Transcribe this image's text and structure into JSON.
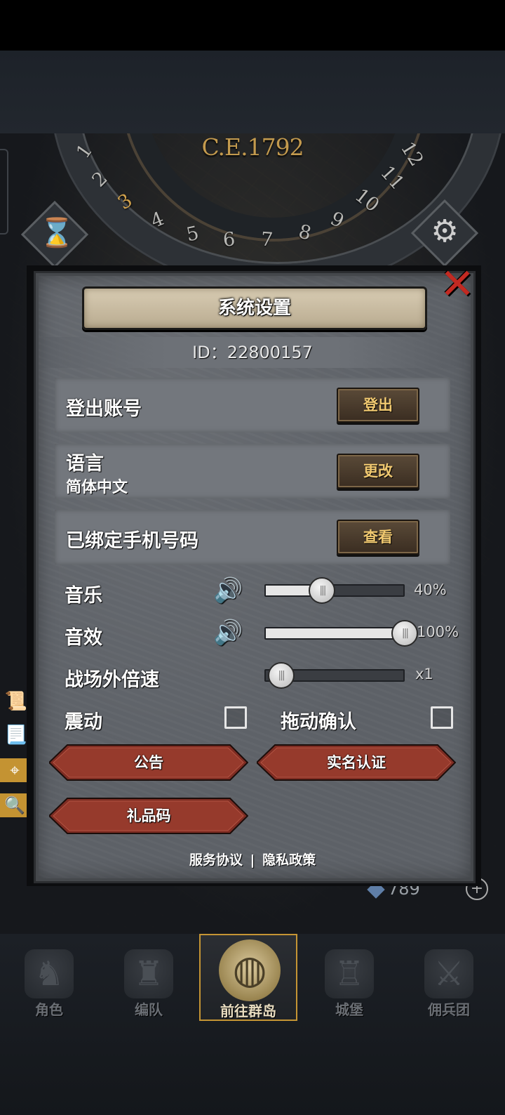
{
  "calendar": {
    "year": "C.E.1792",
    "months": [
      "1",
      "2",
      "3",
      "4",
      "5",
      "6",
      "7",
      "8",
      "9",
      "10",
      "11",
      "12"
    ],
    "active_month": "3"
  },
  "dialog": {
    "title": "系统设置",
    "id_line": "ID：22800157",
    "rows": [
      {
        "label": "登出账号",
        "button": "登出"
      },
      {
        "label": "语言",
        "sub": "简体中文",
        "button": "更改"
      },
      {
        "label": "已绑定手机号码",
        "button": "查看"
      }
    ],
    "music": {
      "label": "音乐",
      "percent_text": "40%",
      "level": 0.4
    },
    "sfx": {
      "label": "音效",
      "percent_text": "100%",
      "level": 1.0
    },
    "speed": {
      "label": "战场外倍速",
      "value_text": "x1",
      "level": 0.0
    },
    "vibration": {
      "label": "震动",
      "checked": false
    },
    "drag_confirm": {
      "label": "拖动确认",
      "checked": false
    },
    "buttons": {
      "announcement": "公告",
      "realname": "实名认证",
      "giftcode": "礼品码"
    },
    "footer": {
      "service": "服务协议",
      "separator": "|",
      "privacy": "隐私政策"
    }
  },
  "resource": {
    "value": "789"
  },
  "nav": [
    {
      "label": "角色",
      "icon": "knight-helmet-icon"
    },
    {
      "label": "编队",
      "icon": "helmet-icon"
    },
    {
      "label": "前往群岛",
      "icon": "globe-icon",
      "active": true
    },
    {
      "label": "城堡",
      "icon": "castle-icon"
    },
    {
      "label": "佣兵团",
      "icon": "mercenary-icon"
    }
  ],
  "colors": {
    "accent_gold": "#c59534",
    "button_red": "#8a3226",
    "close_red": "#c22a22"
  }
}
